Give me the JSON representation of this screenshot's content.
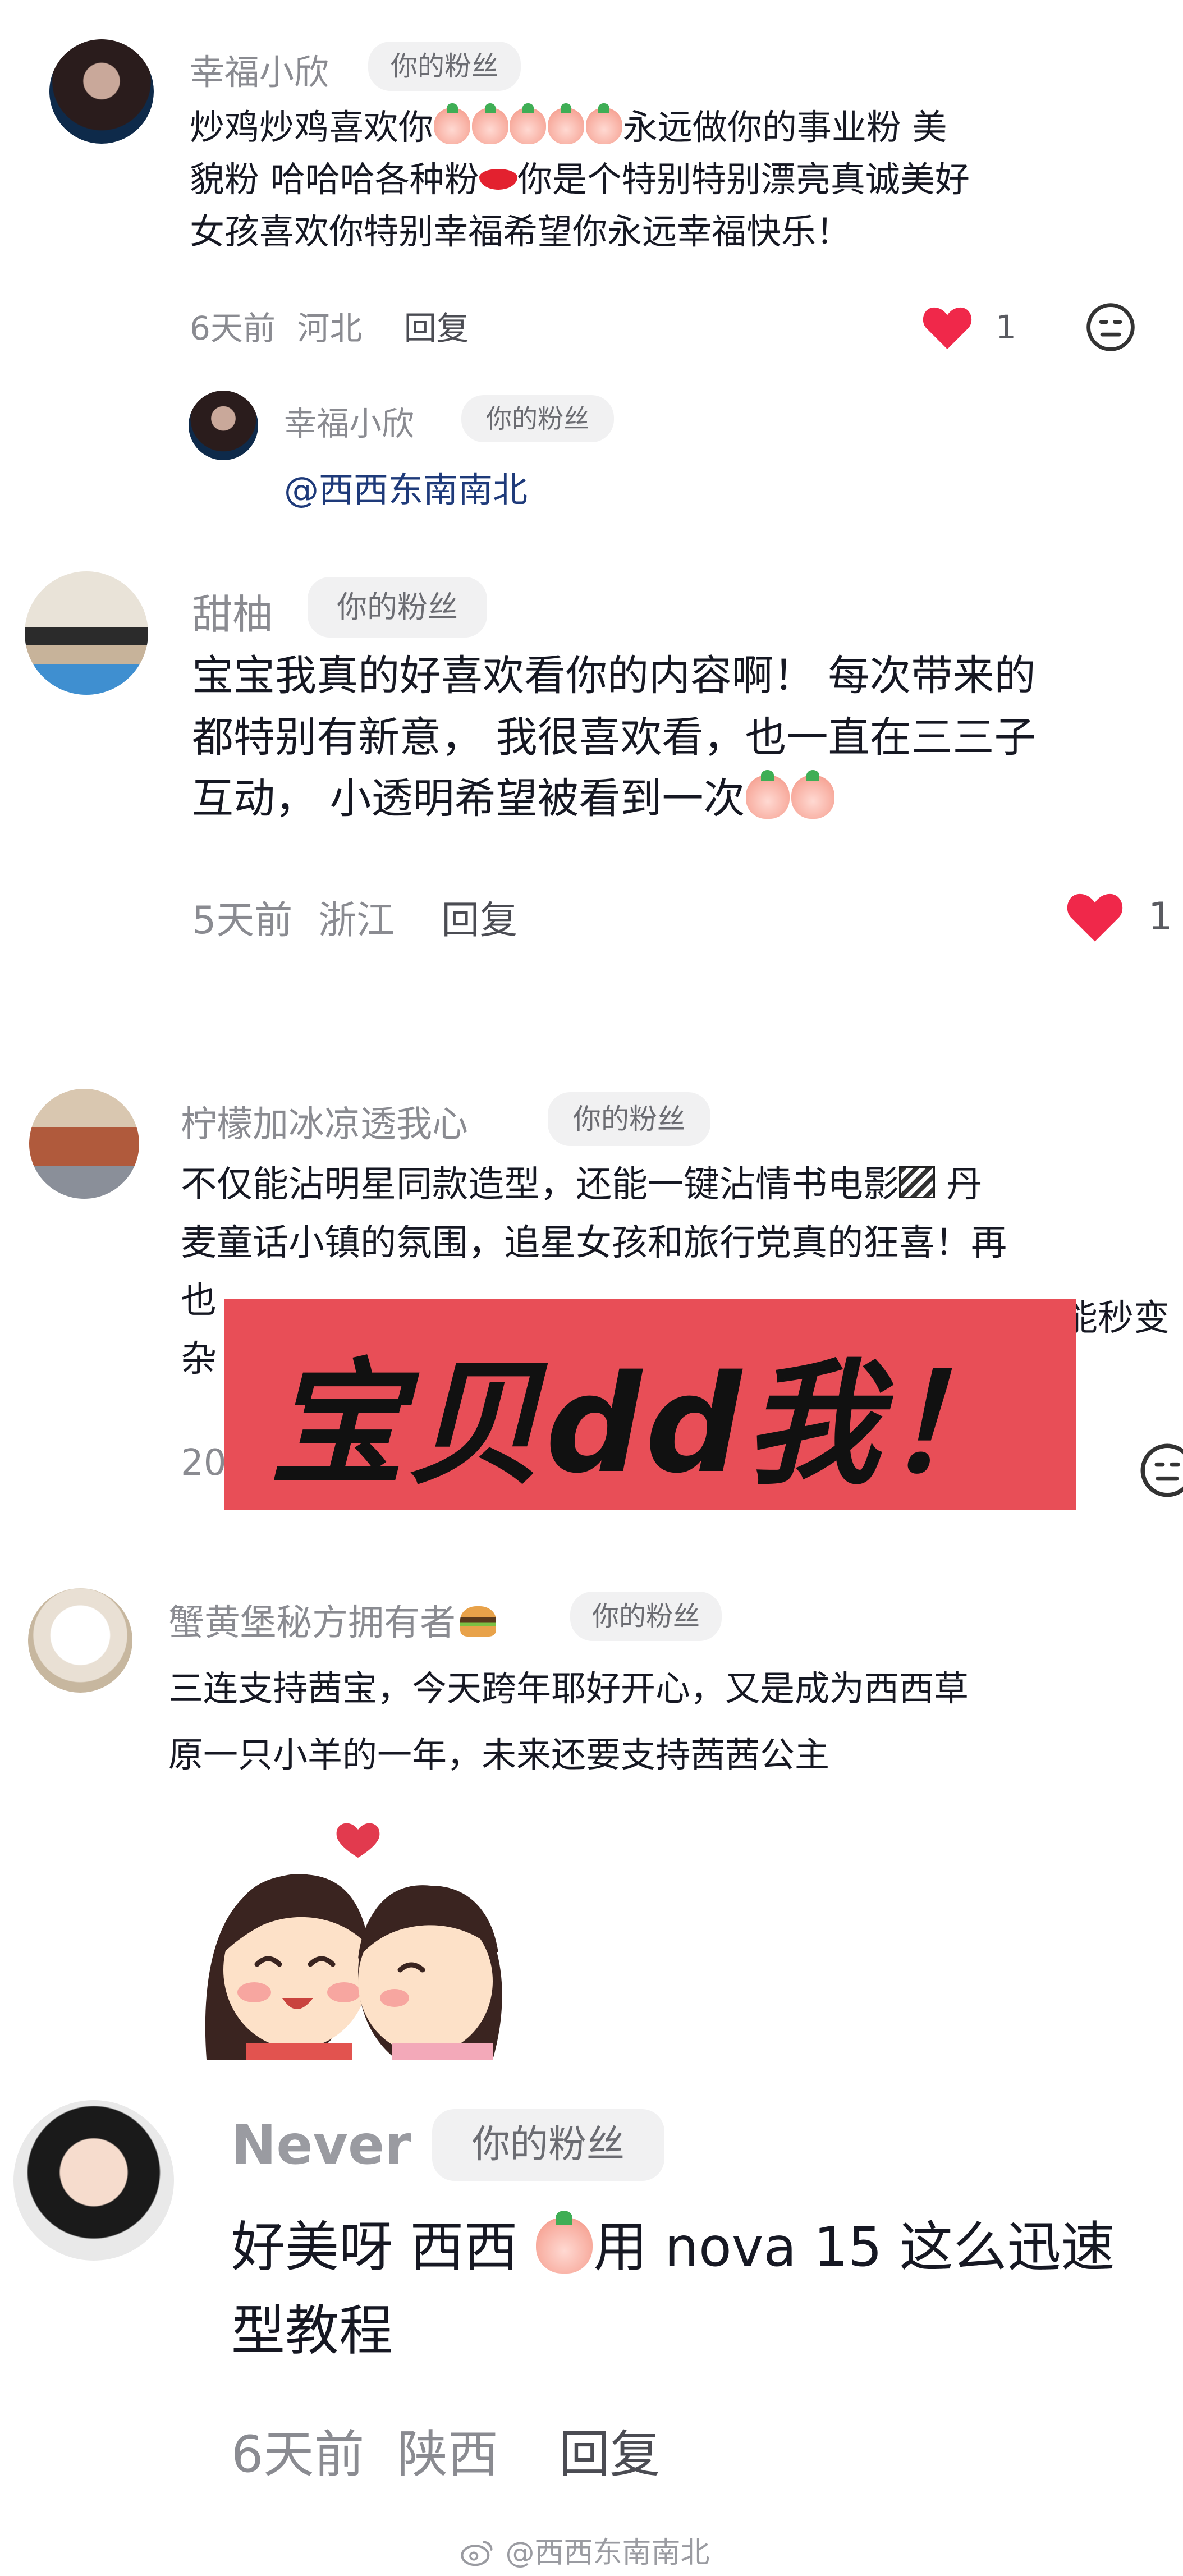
{
  "comments": [
    {
      "username": "幸福小欣",
      "badge": "你的粉丝",
      "text_parts": [
        "炒鸡炒鸡喜欢你",
        "永远做你的事业粉 美",
        "貌粉 哈哈哈各种粉",
        "你是个特别特别漂亮真诚美好",
        "女孩喜欢你特别幸福希望你永远幸福快乐！"
      ],
      "time": "6天前",
      "location": "河北",
      "reply_label": "回复",
      "likes": "1",
      "reply": {
        "username": "幸福小欣",
        "badge": "你的粉丝",
        "mention": "@西西东南南北"
      }
    },
    {
      "username": "甜柚",
      "badge": "你的粉丝",
      "text_line1": "宝宝我真的好喜欢看你的内容啊！ 每次带来的",
      "text_line2": "都特别有新意， 我很喜欢看，也一直在三三子",
      "text_line3": "互动， 小透明希望被看到一次",
      "time": "5天前",
      "location": "浙江",
      "reply_label": "回复",
      "likes": "1"
    },
    {
      "username": "柠檬加冰凉透我心",
      "badge": "你的粉丝",
      "text_line1": "不仅能沾明星同款造型，还能一键沾情书电影",
      "text_line1_tail": " 丹",
      "text_line2": "麦童话小镇的氛围，追星女孩和旅行党真的狂喜！再",
      "text_line3_start": "也",
      "text_line3_end": "能秒变",
      "text_line4_start": "杂",
      "time_partial": "20"
    },
    {
      "username": "蟹黄堡秘方拥有者",
      "badge": "你的粉丝",
      "text_line1": "三连支持茜宝，今天跨年耶好开心，又是成为西西草",
      "text_line2": "原一只小羊的一年，未来还要支持茜茜公主"
    },
    {
      "username": "Never",
      "badge": "你的粉丝",
      "text_line1_a": "好美呀 西西 ",
      "text_line1_b": "用 nova 15 这么迅速",
      "text_line2": "型教程",
      "time": "6天前",
      "location": "陕西",
      "reply_label": "回复"
    }
  ],
  "banner": {
    "text": "宝贝dd我！",
    "color": "#e84e57"
  },
  "watermark": "@西西东南南北",
  "colors": {
    "heart": "#f0284a",
    "mention": "#1e3a7a",
    "badge_bg": "#f1f1f2"
  },
  "icons": [
    "heart-icon",
    "dislike-face-icon",
    "weibo-icon"
  ]
}
